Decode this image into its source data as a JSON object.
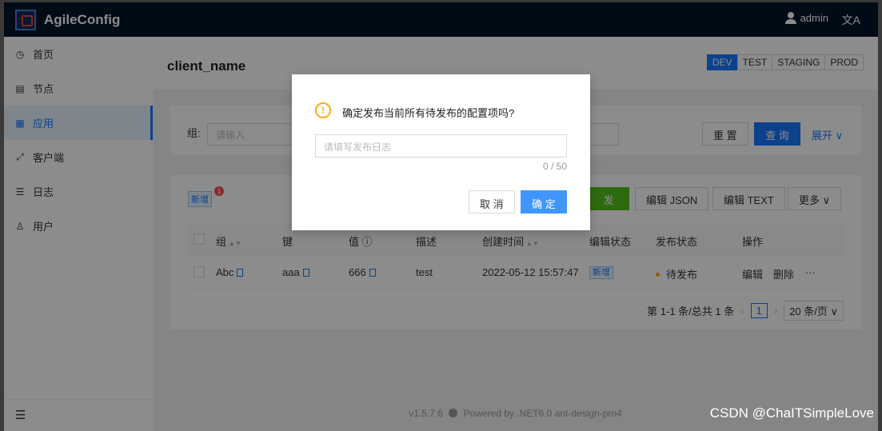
{
  "app": {
    "title": "AgileConfig"
  },
  "header": {
    "user": "admin",
    "lang_icon": "文A"
  },
  "sidebar": {
    "items": [
      {
        "label": "首页",
        "icon": "◷"
      },
      {
        "label": "节点",
        "icon": "▤"
      },
      {
        "label": "应用",
        "icon": "▦"
      },
      {
        "label": "客户端",
        "icon": "⤢"
      },
      {
        "label": "日志",
        "icon": "☰"
      },
      {
        "label": "用户",
        "icon": "♙"
      }
    ],
    "collapse_icon": "☰"
  },
  "page": {
    "title": "client_name",
    "envs": [
      "DEV",
      "TEST",
      "STAGING",
      "PROD"
    ],
    "active_env": "DEV"
  },
  "filter": {
    "group_label": "组:",
    "group_placeholder": "请输入",
    "reset": "重 置",
    "query": "查 询",
    "expand": "展开 ∨"
  },
  "toolbar": {
    "new_tag": "新增",
    "new_count": "1",
    "publish": "发布",
    "edit_json": "编辑 JSON",
    "edit_text": "编辑 TEXT",
    "more": "更多 ∨"
  },
  "table": {
    "headers": [
      "组",
      "键",
      "值 ⓘ",
      "描述",
      "创建时间",
      "编辑状态",
      "发布状态",
      "操作"
    ],
    "rows": [
      {
        "group": "Abc",
        "key": "aaa",
        "value": "666",
        "desc": "test",
        "created": "2022-05-12 15:57:47",
        "edit_status": "新增",
        "publish_status": "待发布",
        "edit": "编辑",
        "delete": "删除",
        "more": "···"
      }
    ]
  },
  "pagination": {
    "summary": "第 1-1 条/总共 1 条",
    "prev": "‹",
    "current": "1",
    "next": "›",
    "page_size": "20 条/页 ∨"
  },
  "footer": {
    "version": "v1.5.7.6",
    "powered": "Powered by .NET6.0 ant-design-pro4"
  },
  "modal": {
    "title": "确定发布当前所有待发布的配置项吗?",
    "input_placeholder": "请填写发布日志",
    "counter": "0 / 50",
    "cancel": "取 消",
    "ok": "确 定",
    "icon": "!"
  },
  "watermark": "CSDN @ChaITSimpleLove"
}
